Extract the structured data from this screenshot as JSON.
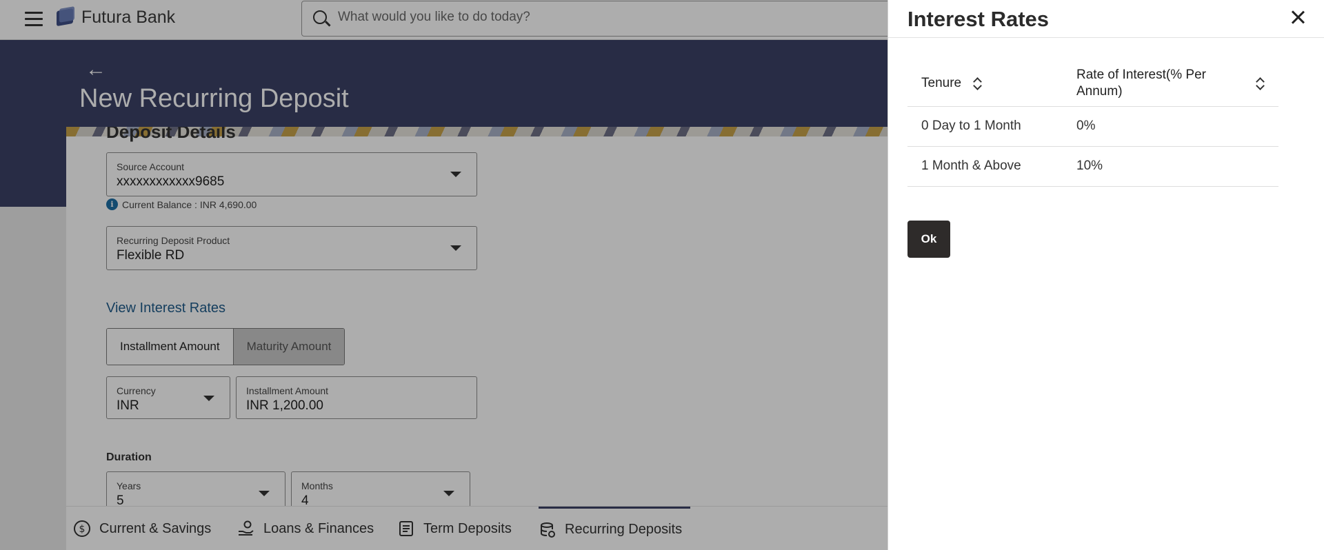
{
  "topbar": {
    "brand": "Futura Bank",
    "search_placeholder": "What would you like to do today?"
  },
  "header": {
    "page_title": "New Recurring Deposit"
  },
  "form": {
    "section_title": "Deposit Details",
    "source_account": {
      "label": "Source Account",
      "value": "xxxxxxxxxxxx9685"
    },
    "balance_info": "Current Balance : INR 4,690.00",
    "product": {
      "label": "Recurring Deposit Product",
      "value": "Flexible RD"
    },
    "view_rates_link": "View Interest Rates",
    "toggle": {
      "installment": "Installment Amount",
      "maturity": "Maturity Amount"
    },
    "currency": {
      "label": "Currency",
      "value": "INR"
    },
    "installment": {
      "label": "Installment Amount",
      "value": "INR 1,200.00"
    },
    "duration_label": "Duration",
    "years": {
      "label": "Years",
      "value": "5"
    },
    "months": {
      "label": "Months",
      "value": "4"
    }
  },
  "tabs": [
    {
      "label": "Current & Savings",
      "icon": "dollar-circle-icon"
    },
    {
      "label": "Loans & Finances",
      "icon": "hand-coin-icon"
    },
    {
      "label": "Term Deposits",
      "icon": "document-list-icon"
    },
    {
      "label": "Recurring Deposits",
      "icon": "coin-stack-icon",
      "active": true
    }
  ],
  "panel": {
    "title": "Interest Rates",
    "columns": [
      "Tenure",
      "Rate of Interest(% Per Annum)"
    ],
    "rows": [
      {
        "tenure": "0 Day to 1 Month",
        "rate": "0%"
      },
      {
        "tenure": "1 Month & Above",
        "rate": "10%"
      }
    ],
    "ok_label": "Ok"
  },
  "colors": {
    "header_band": "#3b4266",
    "link": "#1f5c8b",
    "info_icon": "#1d6fa5",
    "ok_button": "#2e2b2a"
  }
}
